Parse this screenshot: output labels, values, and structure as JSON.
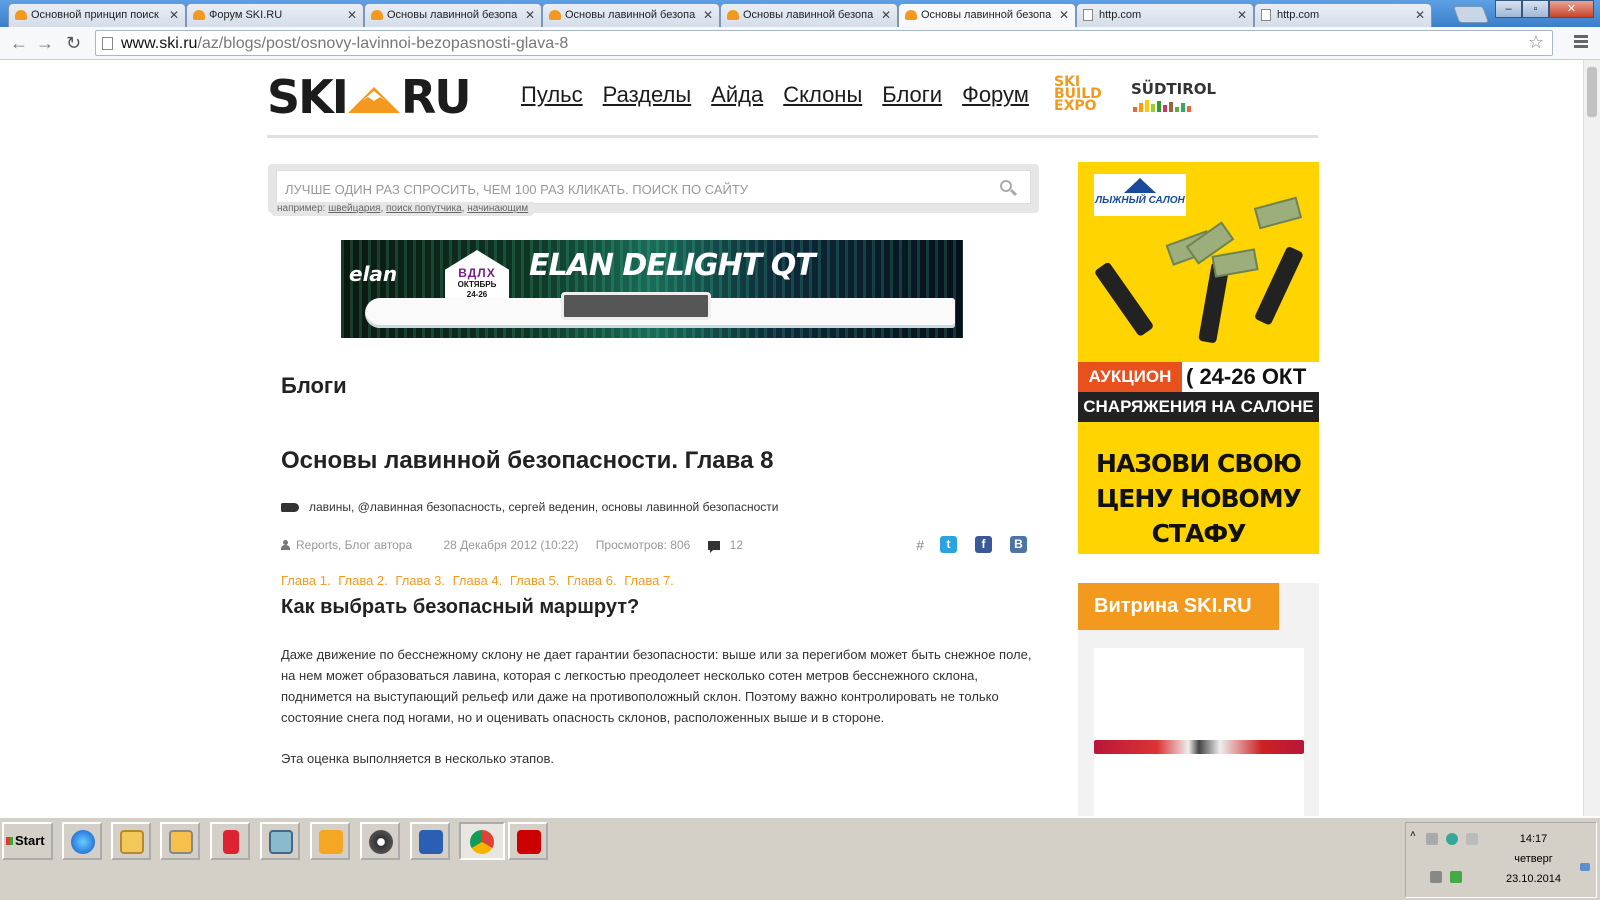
{
  "browser": {
    "tabs": [
      {
        "title": "Основной принцип поиск",
        "icon": "ski-favicon"
      },
      {
        "title": "Форум SKI.RU",
        "icon": "ski-favicon"
      },
      {
        "title": "Основы лавинной безопа",
        "icon": "ski-favicon"
      },
      {
        "title": "Основы лавинной безопа",
        "icon": "ski-favicon"
      },
      {
        "title": "Основы лавинной безопа",
        "icon": "ski-favicon"
      },
      {
        "title": "Основы лавинной безопа",
        "icon": "ski-favicon",
        "active": true
      },
      {
        "title": "http.com",
        "icon": "page-icon"
      },
      {
        "title": "http.com",
        "icon": "page-icon"
      }
    ],
    "url_host": "www.ski.ru",
    "url_path": "/az/blogs/post/osnovy-lavinnoi-bezopasnosti-glava-8"
  },
  "site": {
    "logo_left": "SKI",
    "logo_right": "RU",
    "nav": [
      "Пульс",
      "Разделы",
      "Айда",
      "Склоны",
      "Блоги",
      "Форум"
    ],
    "partner1": [
      "SKI",
      "BUILD",
      "EXPO"
    ],
    "partner2": "SÜDTIROL",
    "accent": "#f39a1e"
  },
  "search": {
    "placeholder": "Лучше один раз спросить, чем 100 раз кликать. Поиск по сайту",
    "hint_prefix": "например:",
    "hint_links": [
      "швейцария",
      "поиск попутчика",
      "начинающим"
    ]
  },
  "banner": {
    "brand": "elan",
    "event": "ВДЛХ",
    "event_month": "ОКТЯБРЬ",
    "event_dates": "24-26",
    "title": "ELAN DELIGHT QT"
  },
  "article": {
    "section": "Блоги",
    "title": "Основы лавинной безопасности. Глава 8",
    "tags": "лавины, @лавинная безопасность, сергей веденин, основы лавинной безопасности",
    "author": "Reports, Блог автора",
    "date": "28 Декабря 2012 (10:22)",
    "views": "Просмотров: 806",
    "comments": "12",
    "hash": "#",
    "chapters": [
      "Глава 1.",
      "Глава 2.",
      "Глава 3.",
      "Глава 4.",
      "Глава 5.",
      "Глава 6.",
      "Глава 7."
    ],
    "subheading": "Как выбрать безопасный маршрут?",
    "paragraphs": [
      "Даже движение по бесснежному склону не дает гарантии безопасности: выше или за перегибом может быть снежное поле, на нем может образоваться лавина, которая с легкостью преодолеет несколько сотен метров бесснежного склона, поднимется на выступающий рельеф или даже на противоположный склон. Поэтому важно контролировать не только состояние снега под ногами, но и оценивать опасность склонов, расположенных выше и в стороне.",
      "Эта оценка выполняется в несколько этапов."
    ]
  },
  "sidebar": {
    "ad_brand": "ЛЫЖНЫЙ САЛОН",
    "ad_auction": "АУКЦИОН",
    "ad_dates": "( 24-26 ОКТ )",
    "ad_band": "СНАРЯЖЕНИЯ НА САЛОНЕ",
    "ad_slogan": "НАЗОВИ СВОЮ ЦЕНУ НОВОМУ СТАФУ",
    "vitrina_title": "Витрина SKI.RU"
  },
  "taskbar": {
    "start": "Start",
    "apps": [
      "internet-explorer",
      "file-explorer",
      "media-player",
      "book-app",
      "control-panel",
      "outlook",
      "disc-app",
      "word",
      "chrome",
      "acrobat"
    ],
    "time": "14:17",
    "day": "четверг",
    "date": "23.10.2014"
  }
}
